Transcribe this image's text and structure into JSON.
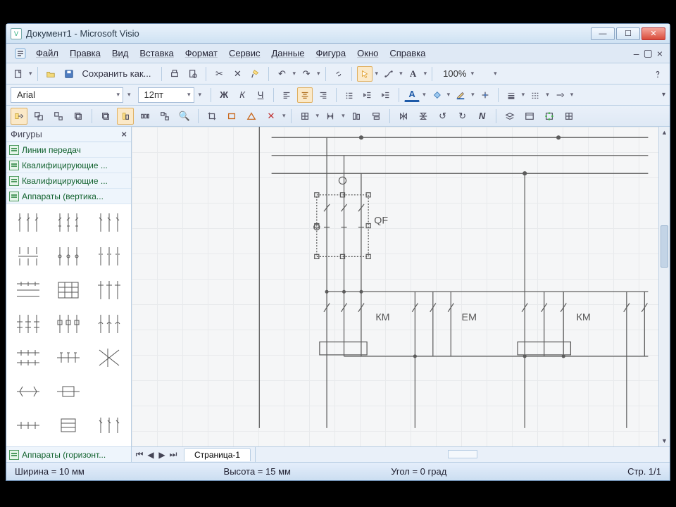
{
  "window": {
    "title": "Документ1 - Microsoft Visio"
  },
  "menu": {
    "file": "Файл",
    "edit": "Правка",
    "view": "Вид",
    "insert": "Вставка",
    "format": "Формат",
    "tools": "Сервис",
    "data": "Данные",
    "shape": "Фигура",
    "window": "Окно",
    "help": "Справка"
  },
  "toolbar1": {
    "save_as": "Сохранить как...",
    "zoom": "100%"
  },
  "toolbar2": {
    "font": "Arial",
    "size": "12пт"
  },
  "shapes": {
    "title": "Фигуры",
    "stencils": [
      "Линии передач",
      "Квалифицирующие ...",
      "Квалифицирующие ...",
      "Аппараты (вертика..."
    ],
    "bottom_stencil": "Аппараты (горизонт..."
  },
  "canvas": {
    "label_qf": "QF",
    "label_km1": "КМ",
    "label_em": "EМ",
    "label_km2": "КМ"
  },
  "tabs": {
    "page1": "Страница-1"
  },
  "status": {
    "width": "Ширина = 10 мм",
    "height": "Высота = 15 мм",
    "angle": "Угол = 0 град",
    "page": "Стр. 1/1"
  }
}
